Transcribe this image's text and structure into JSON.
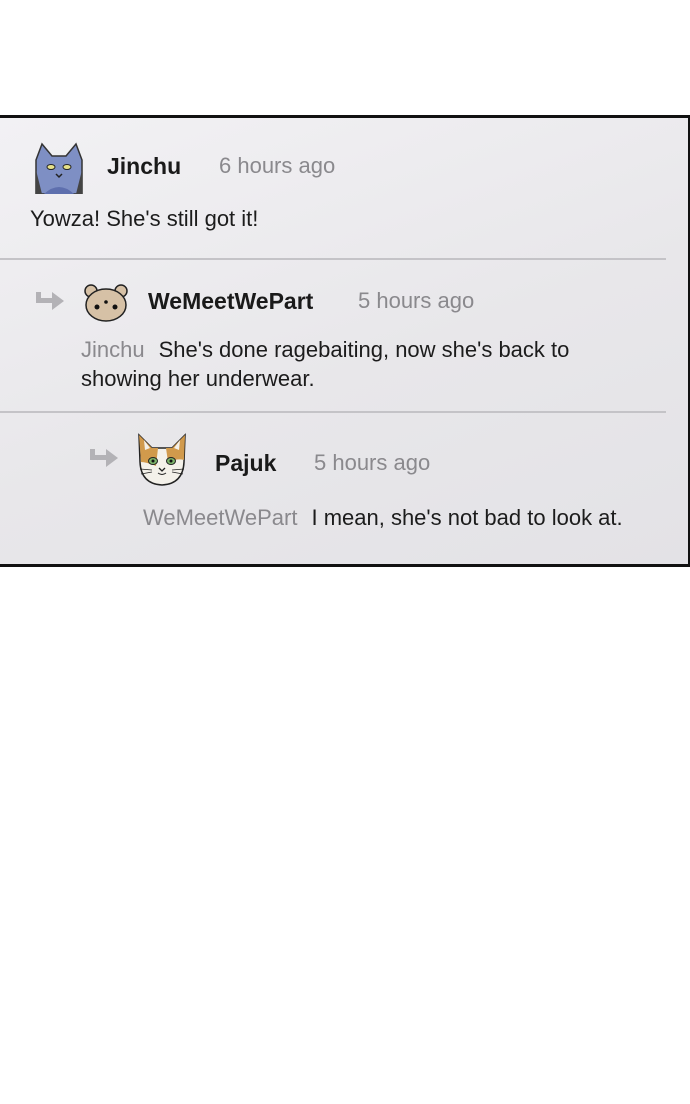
{
  "comments": [
    {
      "username": "Jinchu",
      "time": "6 hours ago",
      "text": "Yowza! She's still got it!",
      "avatar_icon": "blue-cat-avatar-icon"
    },
    {
      "username": "WeMeetWePart",
      "time": "5 hours ago",
      "reply_to": "Jinchu",
      "text_line1": "She's done ragebaiting, now she's back to",
      "text_line2": "showing her underwear.",
      "avatar_icon": "tan-bear-avatar-icon"
    },
    {
      "username": "Pajuk",
      "time": "5 hours ago",
      "reply_to": "WeMeetWePart",
      "text": "I mean, she's not bad to look at.",
      "avatar_icon": "calico-cat-avatar-icon"
    }
  ],
  "colors": {
    "panel_bg": "#ecebee",
    "muted_text": "#8a898d",
    "divider": "#c4c3c7",
    "border": "#111111"
  }
}
